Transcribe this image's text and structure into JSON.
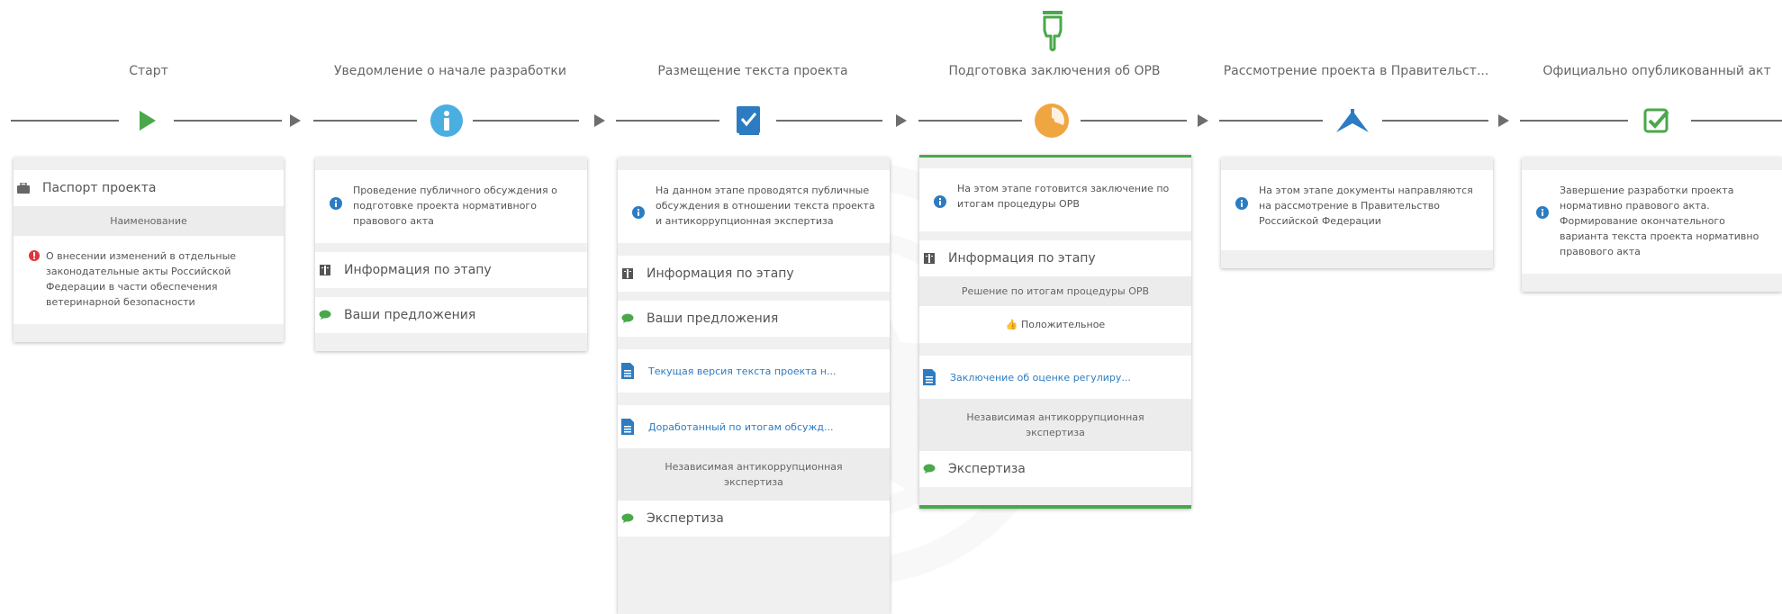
{
  "stages": [
    {
      "title": "Старт",
      "icon": "play-icon"
    },
    {
      "title": "Уведомление о начале разработки",
      "icon": "info-circle-icon"
    },
    {
      "title": "Размещение текста проекта",
      "icon": "document-check-icon"
    },
    {
      "title": "Подготовка заключения об ОРВ",
      "icon": "pie-chart-icon"
    },
    {
      "title": "Рассмотрение проекта в Правительст...",
      "icon": "flag-icon"
    },
    {
      "title": "Официально опубликованный акт",
      "icon": "checkbox-icon"
    }
  ],
  "current_stage_marker": "hand-pointer-icon",
  "cards": {
    "start": {
      "passport_label": "Паспорт проекта",
      "name_label": "Наименование",
      "project_name": "О внесении изменений в отдельные законодательные акты Российской Федерации в части обеспечения ветеринарной безопасности"
    },
    "notice": {
      "info": "Проведение публичного обсуждения о подготовке проекта нормативного правового акта",
      "stage_info_label": "Информация по этапу",
      "proposals_label": "Ваши предложения"
    },
    "placement": {
      "info": "На данном этапе проводятся публичные обсуждения в отношении текста проекта и антикоррупционная экспертиза",
      "stage_info_label": "Информация по этапу",
      "proposals_label": "Ваши предложения",
      "doc1": "Текущая версия текста проекта н...",
      "doc2": "Доработанный по итогам обсужд...",
      "expertise_header": "Независимая антикоррупционная экспертиза",
      "expertise_label": "Экспертиза"
    },
    "orv": {
      "info": "На этом этапе готовится заключение по итогам процедуры ОРВ",
      "stage_info_label": "Информация по этапу",
      "decision_header": "Решение по итогам процедуры ОРВ",
      "decision_value": "Положительное",
      "doc1": "Заключение об оценке регулиру...",
      "expertise_header": "Независимая антикоррупционная экспертиза",
      "expertise_label": "Экспертиза"
    },
    "government": {
      "info": "На этом этапе документы направляются на рассмотрение в Правительство Российской Федерации"
    },
    "published": {
      "info": "Завершение разработки проекта нормативно правового акта. Формирование окончательного варианта текста проекта нормативно правового акта"
    }
  },
  "colors": {
    "green": "#4aa84a",
    "blue": "#2d7cc1",
    "info_blue": "#4aaee0",
    "orange": "#f0a640",
    "error_red": "#e0353b",
    "line": "#6d6d6d"
  }
}
